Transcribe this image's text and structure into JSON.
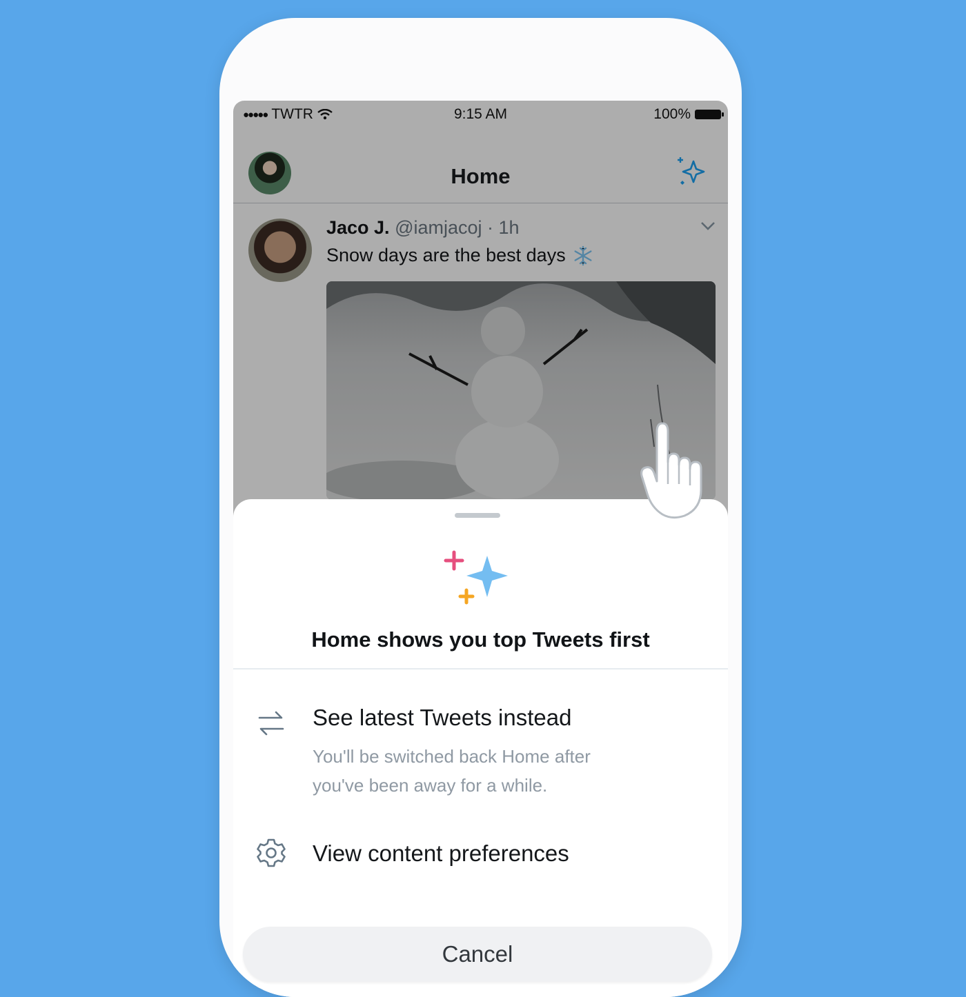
{
  "status_bar": {
    "carrier": "TWTR",
    "time": "9:15 AM",
    "battery": "100%"
  },
  "nav": {
    "title": "Home"
  },
  "tweet": {
    "name": "Jaco J.",
    "handle_time": "@iamjacoj · 1h",
    "text": "Snow days are the best days"
  },
  "sheet": {
    "heading": "Home shows you top Tweets first",
    "options": [
      {
        "label": "See latest Tweets instead",
        "sub_line_1": "You'll be switched back Home after",
        "sub_line_2": "you've been away for a while."
      },
      {
        "label": "View content preferences"
      }
    ],
    "cancel_label": "Cancel"
  },
  "colors": {
    "background": "#58a6ea",
    "twitter_blue": "#1da1f2",
    "sparkle_blue": "#74bdf1",
    "sparkle_pink": "#e0245e",
    "sparkle_yellow": "#f5a623"
  }
}
